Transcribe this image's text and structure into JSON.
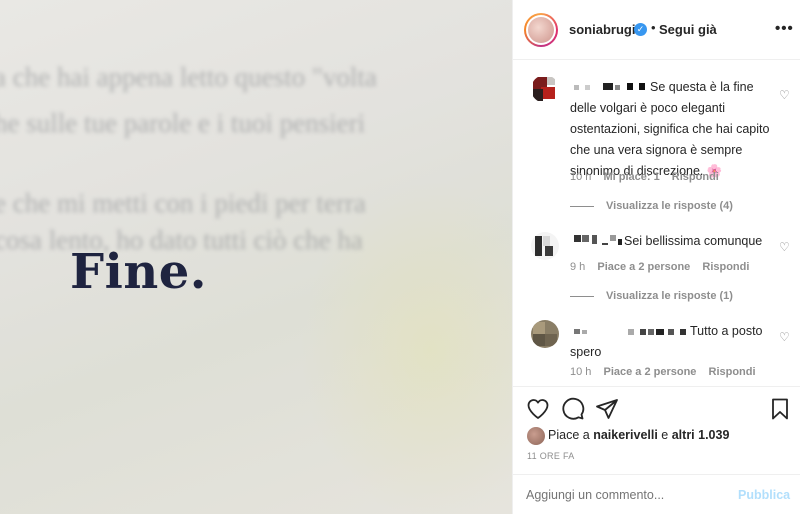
{
  "post": {
    "photo_text": "Fine.",
    "photo_blur_lines": [
      "a che hai appena letto questo \"volta",
      "he sulle tue parole e i tuoi pensieri",
      "e che mi metti con i piedi per terra",
      "cosa lento, ho dato tutti ciò che ha"
    ]
  },
  "header": {
    "username": "soniabrugi",
    "separator": "•",
    "follow_label": "Segui già",
    "more_label": "•••"
  },
  "comments": [
    {
      "text": "Se questa è la fine delle volgari è poco eleganti ostentazioni, significa che hai capito che una vera signora è sempre sinonimo di discrezione. 🌸",
      "time": "10 h",
      "likes": "Mi piace: 1",
      "reply": "Rispondi",
      "view_replies": "Visualizza le risposte (4)"
    },
    {
      "text": "Sei bellissima comunque",
      "time": "9 h",
      "likes": "Piace a 2 persone",
      "reply": "Rispondi",
      "view_replies": "Visualizza le risposte (1)"
    },
    {
      "text": "Tutto a posto spero",
      "time": "10 h",
      "likes": "Piace a 2 persone",
      "reply": "Rispondi"
    }
  ],
  "actions": {
    "likes_prefix": "Piace a",
    "likes_user": "naikerivelli",
    "likes_and": "e",
    "likes_others": "altri 1.039",
    "timestamp": "11 ORE FA"
  },
  "composer": {
    "placeholder": "Aggiungi un commento...",
    "publish_label": "Pubblica"
  },
  "colors": {
    "link_blue": "#b2dffc",
    "verified_blue": "#3897f0",
    "muted": "#8e8e8e"
  },
  "icons": [
    "heart-icon",
    "comment-icon",
    "share-icon",
    "bookmark-icon",
    "more-icon",
    "verified-icon"
  ]
}
